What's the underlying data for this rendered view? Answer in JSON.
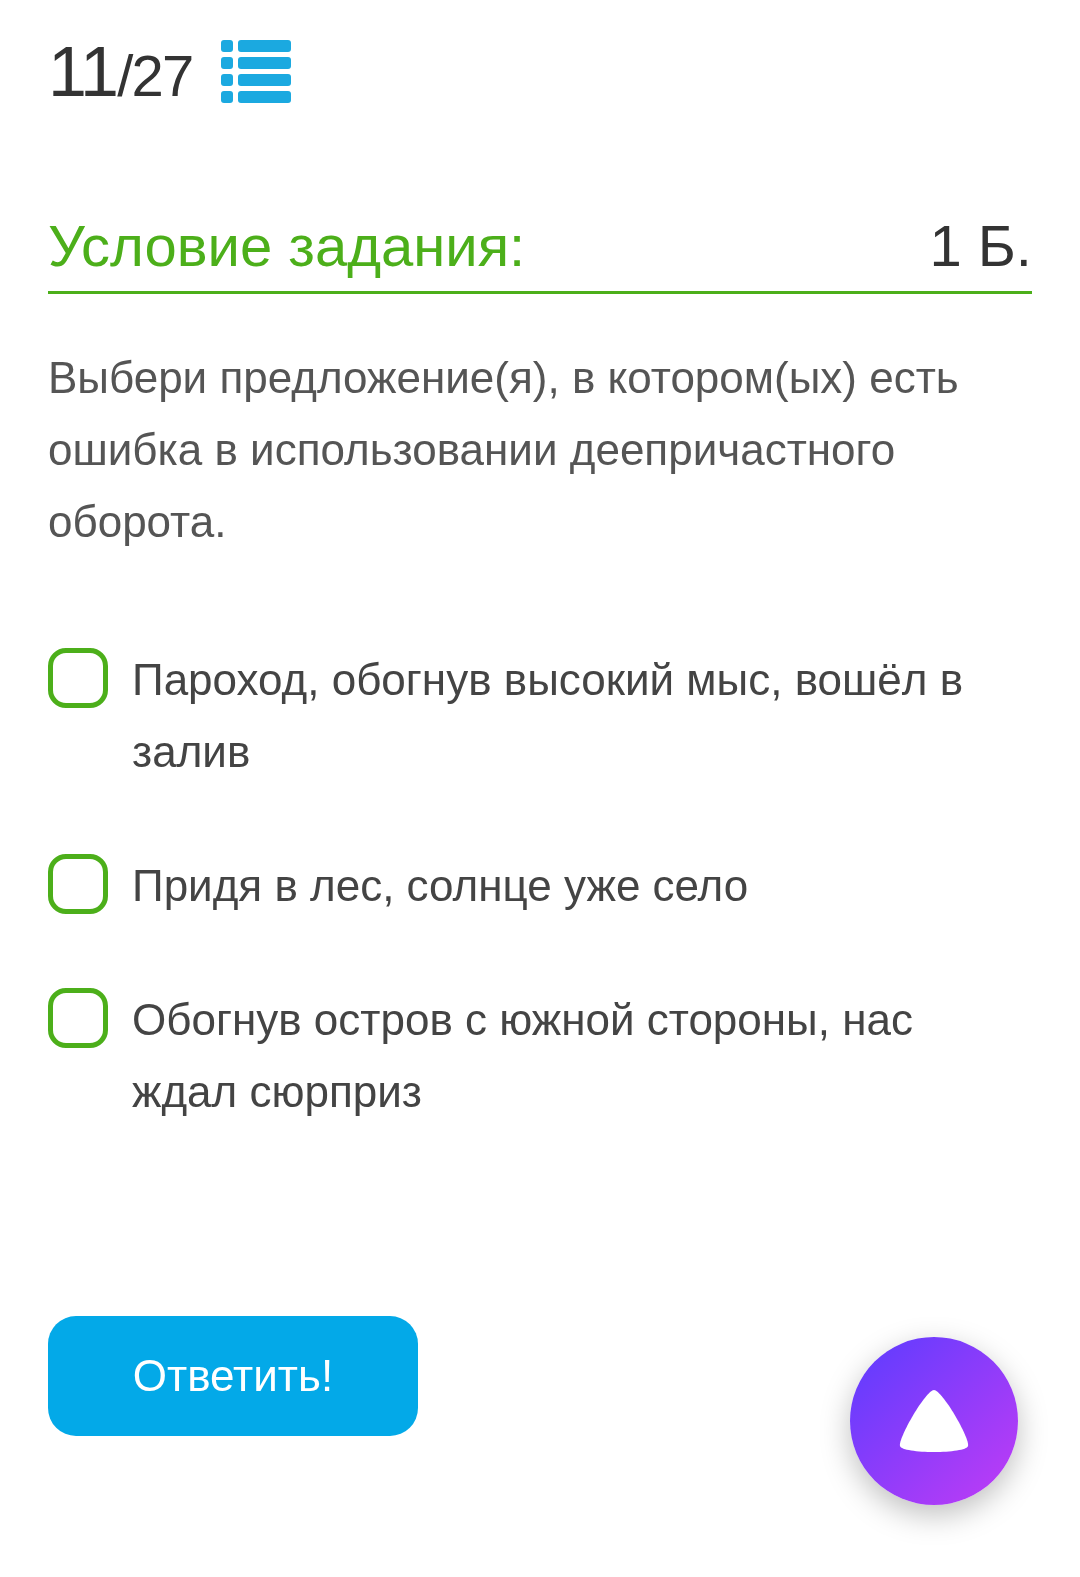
{
  "counter": {
    "current": "11",
    "separator": "/",
    "total": "27"
  },
  "task": {
    "title": "Условие задания:",
    "points": "1 Б.",
    "question": "Выбери предложение(я), в котором(ых) есть ошибка в использовании деепричастного оборота."
  },
  "options": [
    {
      "label": "Пароход, обогнув высокий мыс, вошёл в залив",
      "checked": false
    },
    {
      "label": "Придя в лес, солнце уже село",
      "checked": false
    },
    {
      "label": "Обогнув остров с южной стороны, нас ждал сюрприз",
      "checked": false
    }
  ],
  "answer_button": "Ответить!"
}
